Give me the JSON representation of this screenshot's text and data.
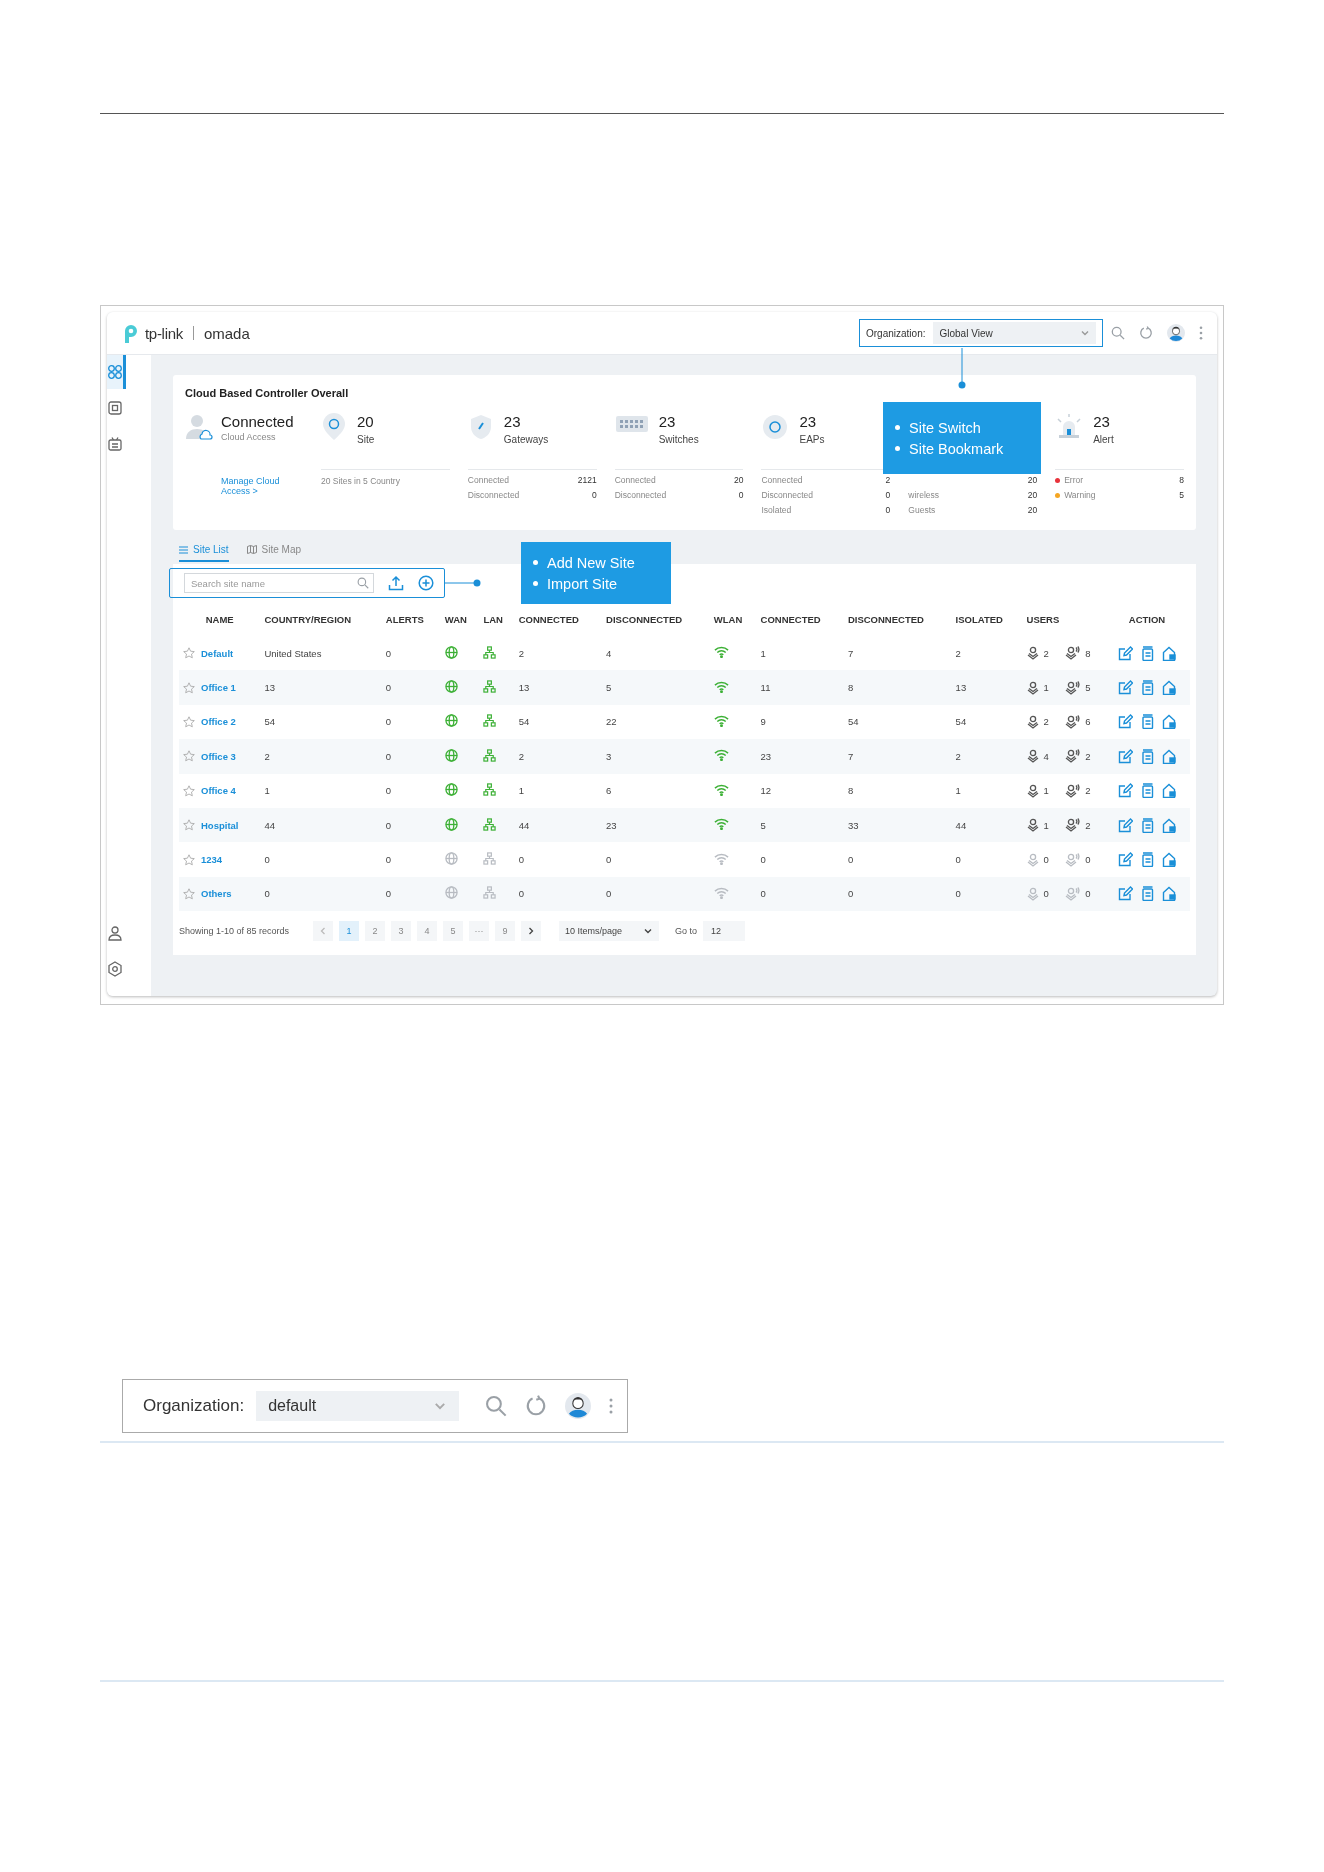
{
  "app_bar": {
    "brand": "tp-link",
    "product": "omada",
    "org_label": "Organization:",
    "org_value": "Global View"
  },
  "sidebar": {
    "items": [
      {
        "kind": "dashboard",
        "selected": true
      },
      {
        "kind": "devices",
        "selected": false
      },
      {
        "kind": "logs",
        "selected": false
      }
    ],
    "bottom": [
      {
        "kind": "account",
        "selected": false
      },
      {
        "kind": "settings",
        "selected": false
      }
    ]
  },
  "overview": {
    "title": "Cloud Based Controller Overall",
    "cloud": {
      "status": "Connected",
      "sub": "Cloud Access",
      "link": "Manage Cloud Access >"
    },
    "cards": [
      {
        "kind": "site",
        "count": "20",
        "label": "Site",
        "note": "20 Sites in 5 Country"
      },
      {
        "kind": "gateway",
        "count": "23",
        "label": "Gateways",
        "rows": [
          {
            "label": "Connected",
            "value": "2121"
          },
          {
            "label": "Disconnected",
            "value": "0"
          }
        ]
      },
      {
        "kind": "switch",
        "count": "23",
        "label": "Switches",
        "rows": [
          {
            "label": "Connected",
            "value": "20"
          },
          {
            "label": "Disconnected",
            "value": "0"
          }
        ]
      },
      {
        "kind": "eap",
        "count": "23",
        "label": "EAPs",
        "rows": [
          {
            "label": "Connected",
            "value": "2"
          },
          {
            "label": "Disconnected",
            "value": "0"
          },
          {
            "label": "Isolated",
            "value": "0"
          }
        ]
      },
      {
        "kind": "clients",
        "rows": [
          {
            "value": "20"
          },
          {
            "label": "wireless",
            "value": "20"
          },
          {
            "label": "Guests",
            "value": "20"
          }
        ]
      },
      {
        "kind": "alert",
        "count": "23",
        "label": "Alert",
        "rows": [
          {
            "label": "Error",
            "value": "8",
            "color": "#e8333b"
          },
          {
            "label": "Warning",
            "value": "5",
            "color": "#f5a623"
          }
        ]
      }
    ]
  },
  "tabs": [
    {
      "label": "Site List",
      "selected": true
    },
    {
      "label": "Site Map",
      "selected": false
    }
  ],
  "search": {
    "placeholder": "Search site name"
  },
  "table": {
    "columns": [
      "NAME",
      "COUNTRY/REGION",
      "ALERTS",
      "WAN",
      "LAN",
      "CONNECTED",
      "DISCONNECTED",
      "WLAN",
      "CONNECTED",
      "DISCONNECTED",
      "ISOLATED",
      "USERS",
      "ACTION"
    ],
    "rows": [
      {
        "name": "Default",
        "country": "United States",
        "alerts": "0",
        "online": true,
        "lan_connected": "2",
        "lan_disconnected": "4",
        "wlan_connected": "1",
        "wlan_disconnected": "7",
        "isolated": "2",
        "users": "2",
        "guests": "8"
      },
      {
        "name": "Office 1",
        "country": "13",
        "alerts": "0",
        "online": true,
        "lan_connected": "13",
        "lan_disconnected": "5",
        "wlan_connected": "11",
        "wlan_disconnected": "8",
        "isolated": "13",
        "users": "1",
        "guests": "5"
      },
      {
        "name": "Office 2",
        "country": "54",
        "alerts": "0",
        "online": true,
        "lan_connected": "54",
        "lan_disconnected": "22",
        "wlan_connected": "9",
        "wlan_disconnected": "54",
        "isolated": "54",
        "users": "2",
        "guests": "6"
      },
      {
        "name": "Office 3",
        "country": "2",
        "alerts": "0",
        "online": true,
        "lan_connected": "2",
        "lan_disconnected": "3",
        "wlan_connected": "23",
        "wlan_disconnected": "7",
        "isolated": "2",
        "users": "4",
        "guests": "2"
      },
      {
        "name": "Office 4",
        "country": "1",
        "alerts": "0",
        "online": true,
        "lan_connected": "1",
        "lan_disconnected": "6",
        "wlan_connected": "12",
        "wlan_disconnected": "8",
        "isolated": "1",
        "users": "1",
        "guests": "2"
      },
      {
        "name": "Hospital",
        "country": "44",
        "alerts": "0",
        "online": true,
        "lan_connected": "44",
        "lan_disconnected": "23",
        "wlan_connected": "5",
        "wlan_disconnected": "33",
        "isolated": "44",
        "users": "1",
        "guests": "2"
      },
      {
        "name": "1234",
        "country": "0",
        "alerts": "0",
        "online": false,
        "lan_connected": "0",
        "lan_disconnected": "0",
        "wlan_connected": "0",
        "wlan_disconnected": "0",
        "isolated": "0",
        "users": "0",
        "guests": "0"
      },
      {
        "name": "Others",
        "country": "0",
        "alerts": "0",
        "online": false,
        "lan_connected": "0",
        "lan_disconnected": "0",
        "wlan_connected": "0",
        "wlan_disconnected": "0",
        "isolated": "0",
        "users": "0",
        "guests": "0"
      }
    ]
  },
  "pagination": {
    "summary": "Showing 1-10 of 85 records",
    "pages": [
      {
        "label": "1",
        "selected": true
      },
      {
        "label": "2",
        "selected": false
      },
      {
        "label": "3",
        "selected": false
      },
      {
        "label": "4",
        "selected": false
      },
      {
        "label": "5",
        "selected": false
      },
      {
        "label": "···",
        "selected": false
      },
      {
        "label": "9",
        "selected": false
      }
    ],
    "page_size": "10 Items/page",
    "goto_label": "Go to",
    "goto_value": "12"
  },
  "callouts": [
    {
      "items": [
        "Site Switch",
        "Site Bookmark"
      ]
    },
    {
      "items": [
        "Add New Site",
        "Import Site"
      ]
    }
  ],
  "org_bar": {
    "label": "Organization:",
    "value": "default"
  }
}
